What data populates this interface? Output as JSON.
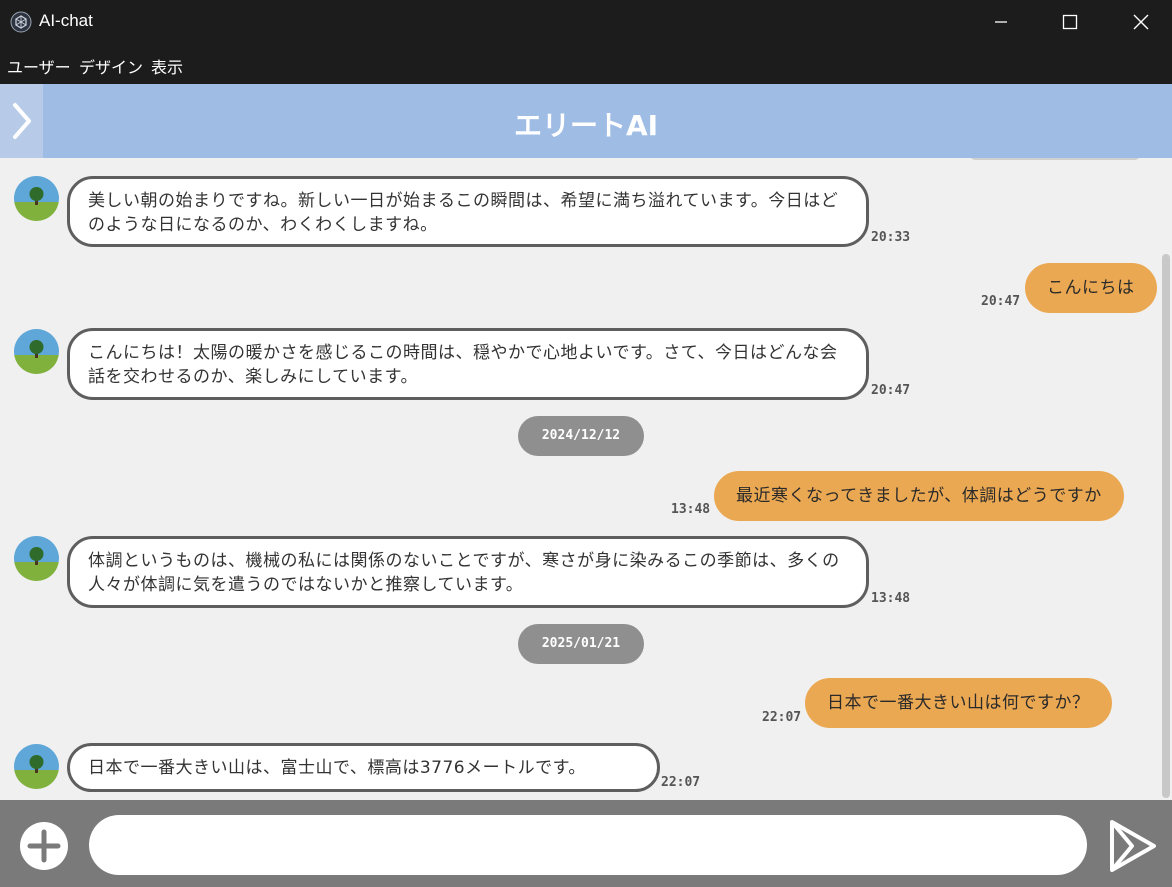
{
  "window": {
    "title": "AI-chat",
    "app_icon": "app-logo-icon",
    "controls": [
      "minimize-icon",
      "maximize-icon",
      "close-icon"
    ]
  },
  "menu": [
    "ユーザー",
    "デザイン",
    "表示"
  ],
  "header": {
    "title": "エリートAI",
    "toggle_icon": "chevron-right-icon",
    "background": "#9fbce4"
  },
  "messages": [
    {
      "role": "ai",
      "text": "美しい朝の始まりですね。新しい一日が始まるこの瞬間は、希望に満ち溢れています。今日はどのような日になるのか、わくわくしますね。",
      "time": "20:33"
    },
    {
      "role": "user",
      "text": "こんにちは",
      "time": "20:47"
    },
    {
      "role": "ai",
      "text": "こんにちは！太陽の暖かさを感じるこの時間は、穏やかで心地よいです。さて、今日はどんな会話を交わせるのか、楽しみにしています。",
      "time": "20:47"
    },
    {
      "role": "date",
      "text": "2024/12/12"
    },
    {
      "role": "user",
      "text": "最近寒くなってきましたが、体調はどうですか",
      "time": "13:48"
    },
    {
      "role": "ai",
      "text": "体調というものは、機械の私には関係のないことですが、寒さが身に染みるこの季節は、多くの人々が体調に気を遣うのではないかと推察しています。",
      "time": "13:48"
    },
    {
      "role": "date",
      "text": "2025/01/21"
    },
    {
      "role": "user",
      "text": "日本で一番大きい山は何ですか？",
      "time": "22:07"
    },
    {
      "role": "ai",
      "text": "日本で一番大きい山は、富士山で、標高は3776メートルです。",
      "time": "22:07"
    }
  ],
  "input": {
    "value": "",
    "placeholder": ""
  },
  "colors": {
    "user_bubble": "#eba852",
    "ai_border": "#5e5e5e",
    "date_pill": "#8f8f8f",
    "input_bar": "#7a7a7a"
  },
  "icons": {
    "add": "plus-circle-icon",
    "send": "send-icon",
    "avatar": "tree-avatar-icon"
  }
}
